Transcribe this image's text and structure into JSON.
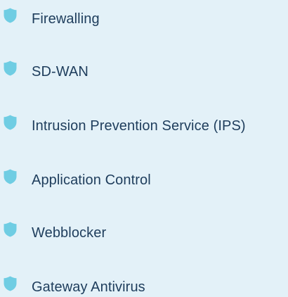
{
  "accent_color": "#6fcde3",
  "text_color": "#1e3d5c",
  "background_color": "#e3f1f8",
  "features": [
    {
      "label": "Firewalling",
      "icon": "shield-icon"
    },
    {
      "label": "SD-WAN",
      "icon": "shield-icon"
    },
    {
      "label": "Intrusion Prevention Service (IPS)",
      "icon": "shield-icon"
    },
    {
      "label": "Application Control",
      "icon": "shield-icon"
    },
    {
      "label": "Webblocker",
      "icon": "shield-icon"
    },
    {
      "label": "Gateway Antivirus",
      "icon": "shield-icon"
    }
  ]
}
